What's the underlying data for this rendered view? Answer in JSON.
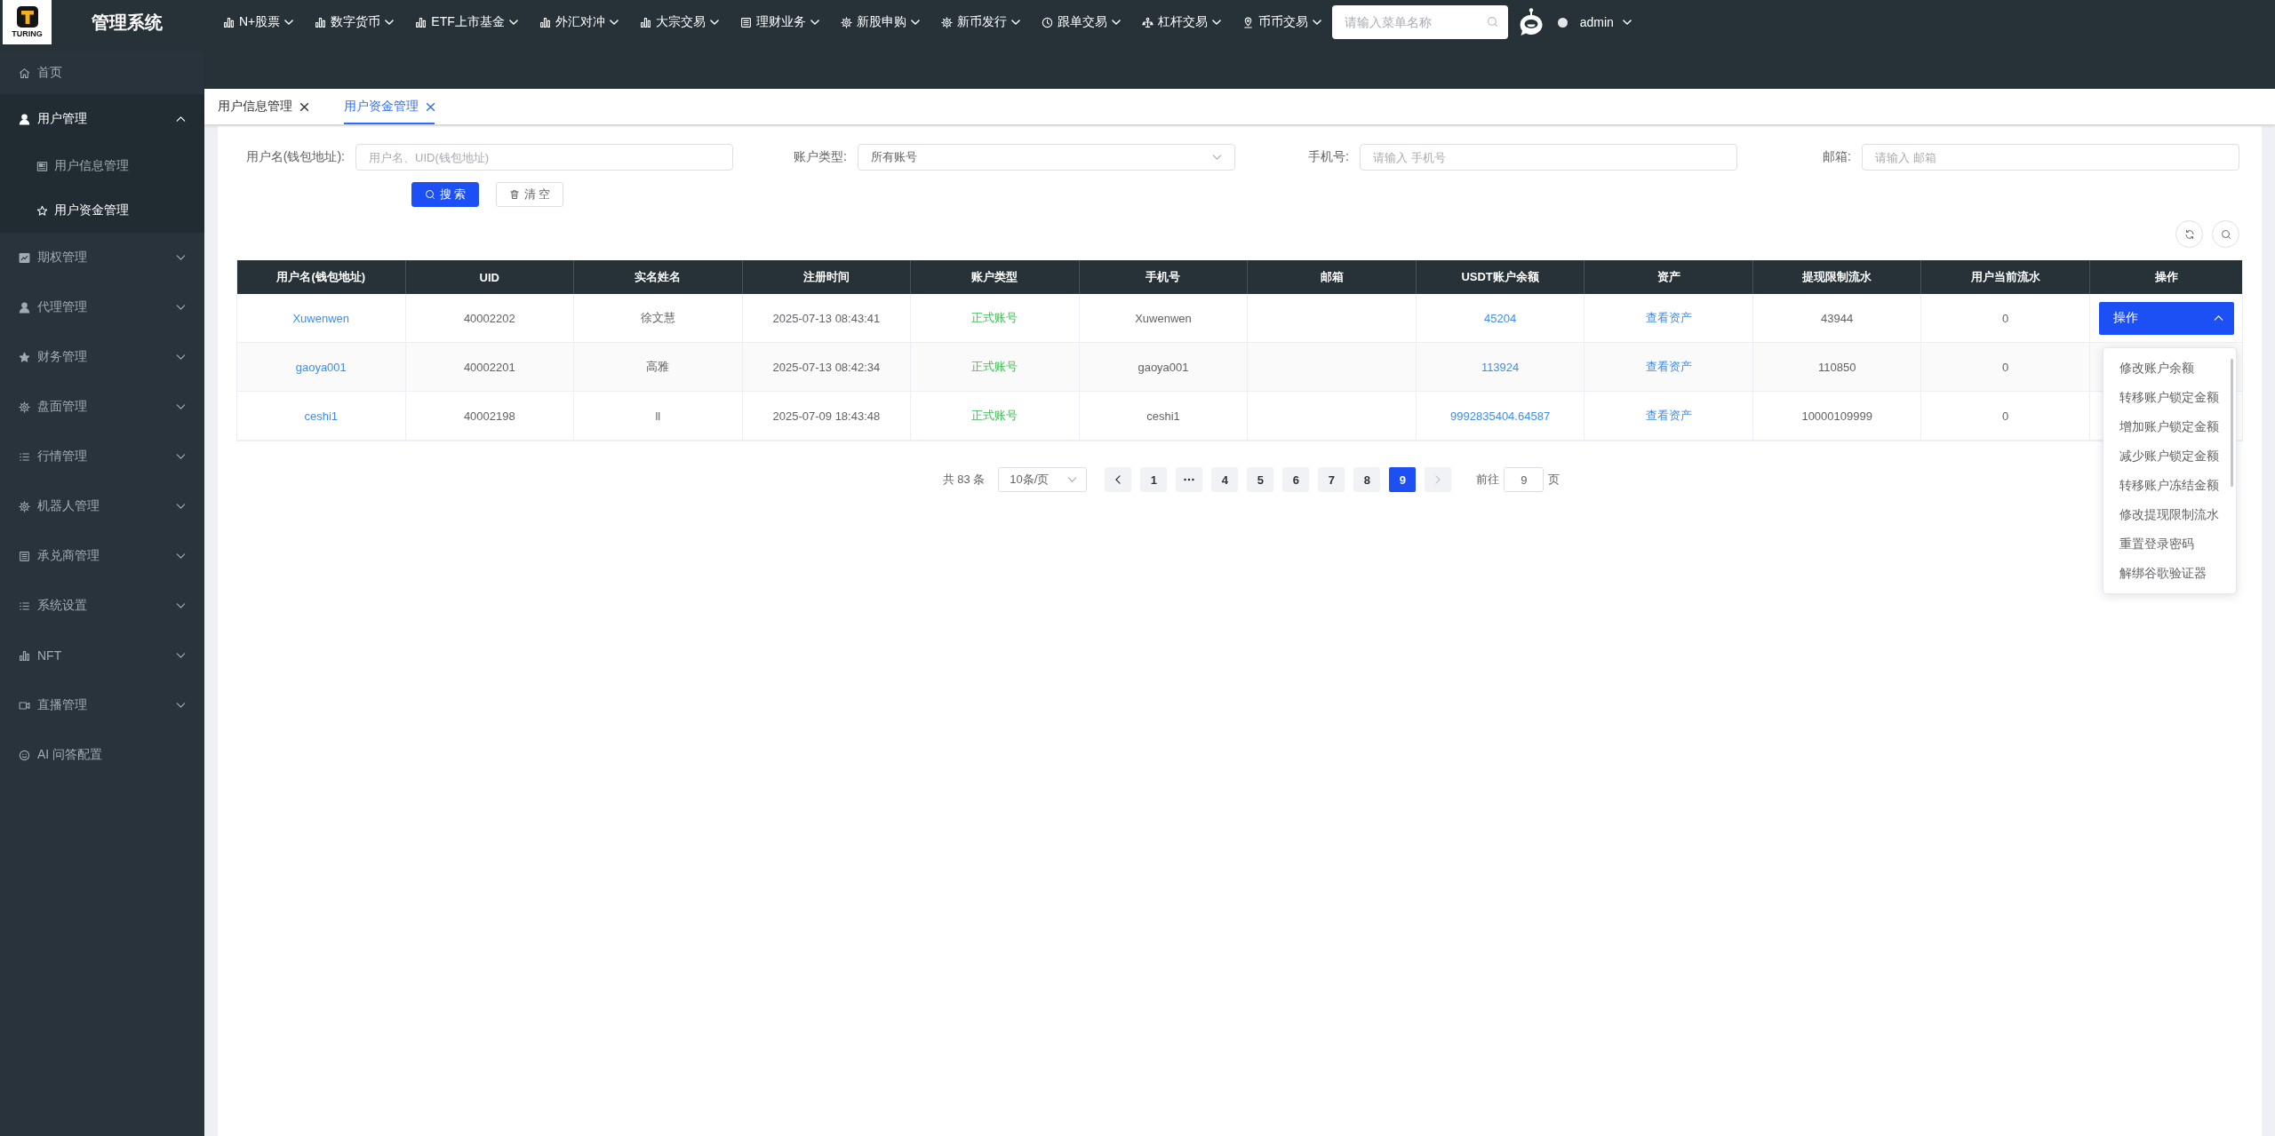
{
  "header": {
    "logo_text": "TURING",
    "title": "管理系统",
    "menu": [
      "N+股票",
      "数字货币",
      "ETF上市基金",
      "外汇对冲",
      "大宗交易",
      "理财业务",
      "新股申购",
      "新币发行",
      "跟单交易",
      "杠杆交易",
      "币币交易"
    ],
    "search": {
      "placeholder": "请输入菜单名称"
    },
    "user": {
      "name": "admin"
    }
  },
  "sidebar": {
    "items": [
      {
        "label": "首页",
        "selected": false
      },
      {
        "label": "用户管理",
        "selected": true,
        "expanded": true,
        "children": [
          {
            "label": "用户信息管理",
            "selected": false
          },
          {
            "label": "用户资金管理",
            "selected": true
          }
        ]
      },
      {
        "label": "期权管理",
        "selected": false,
        "expanded": false
      },
      {
        "label": "代理管理",
        "selected": false,
        "expanded": false
      },
      {
        "label": "财务管理",
        "selected": false,
        "expanded": false
      },
      {
        "label": "盘面管理",
        "selected": false,
        "expanded": false
      },
      {
        "label": "行情管理",
        "selected": false,
        "expanded": false
      },
      {
        "label": "机器人管理",
        "selected": false,
        "expanded": false
      },
      {
        "label": "承兑商管理",
        "selected": false,
        "expanded": false
      },
      {
        "label": "系统设置",
        "selected": false,
        "expanded": false
      },
      {
        "label": "NFT",
        "selected": false,
        "expanded": false
      },
      {
        "label": "直播管理",
        "selected": false,
        "expanded": false
      },
      {
        "label": "AI 问答配置",
        "selected": false
      }
    ]
  },
  "tabs": [
    {
      "label": "用户信息管理",
      "selected": false
    },
    {
      "label": "用户资金管理",
      "selected": true
    }
  ],
  "filters": [
    {
      "label": "用户名(钱包地址):",
      "kind": "input",
      "placeholder": "用户名、UID(钱包地址)"
    },
    {
      "label": "账户类型:",
      "kind": "select",
      "value": "所有账号"
    },
    {
      "label": "手机号:",
      "kind": "input",
      "placeholder": "请输入 手机号"
    },
    {
      "label": "邮箱:",
      "kind": "input",
      "placeholder": "请输入 邮箱"
    }
  ],
  "buttons": [
    {
      "label": "搜 索",
      "kind": "primary"
    },
    {
      "label": "清 空",
      "kind": "plain"
    }
  ],
  "table": {
    "columns": [
      {
        "label": "用户名(钱包地址)",
        "kind": "link"
      },
      {
        "label": "UID",
        "kind": "text"
      },
      {
        "label": "实名姓名",
        "kind": "text"
      },
      {
        "label": "注册时间",
        "kind": "text"
      },
      {
        "label": "账户类型",
        "kind": "status"
      },
      {
        "label": "手机号",
        "kind": "text"
      },
      {
        "label": "邮箱",
        "kind": "text"
      },
      {
        "label": "USDT账户余额",
        "kind": "link"
      },
      {
        "label": "资产",
        "kind": "link"
      },
      {
        "label": "提现限制流水",
        "kind": "text"
      },
      {
        "label": "用户当前流水",
        "kind": "text"
      },
      {
        "label": "操作",
        "kind": "action"
      }
    ],
    "rows": [
      {
        "cells": [
          "Xuwenwen",
          "40002202",
          "徐文慧",
          "2025-07-13 08:43:41",
          "正式账号",
          "Xuwenwen",
          null,
          "45204",
          "查看资产",
          "43944",
          "0"
        ],
        "action": {
          "label": "操作",
          "expanded": true,
          "menu": [
            "修改账户余额",
            "转移账户锁定金额",
            "增加账户锁定金额",
            "减少账户锁定金额",
            "转移账户冻结金额",
            "修改提现限制流水",
            "重置登录密码",
            "解绑谷歌验证器"
          ]
        }
      },
      {
        "cells": [
          "gaoya001",
          "40002201",
          "高雅",
          "2025-07-13 08:42:34",
          "正式账号",
          "gaoya001",
          null,
          "113924",
          "查看资产",
          "110850",
          "0"
        ]
      },
      {
        "cells": [
          "ceshi1",
          "40002198",
          "ll",
          "2025-07-09 18:43:48",
          "正式账号",
          "ceshi1",
          null,
          "9992835404.64587",
          "查看资产",
          "10000109999",
          "0"
        ]
      }
    ]
  },
  "pagination": {
    "total": "共 83 条",
    "page_size": "10条/页",
    "prev": {
      "disabled": false
    },
    "pages": [
      {
        "kind": "page",
        "label": "1",
        "selected": false
      },
      {
        "kind": "more",
        "selected": false
      },
      {
        "kind": "page",
        "label": "4",
        "selected": false
      },
      {
        "kind": "page",
        "label": "5",
        "selected": false
      },
      {
        "kind": "page",
        "label": "6",
        "selected": false
      },
      {
        "kind": "page",
        "label": "7",
        "selected": false
      },
      {
        "kind": "page",
        "label": "8",
        "selected": false
      },
      {
        "kind": "page",
        "label": "9",
        "selected": true
      }
    ],
    "next": {
      "disabled": true
    },
    "jump": {
      "label": "前往",
      "value": "9",
      "unit": "页"
    }
  }
}
